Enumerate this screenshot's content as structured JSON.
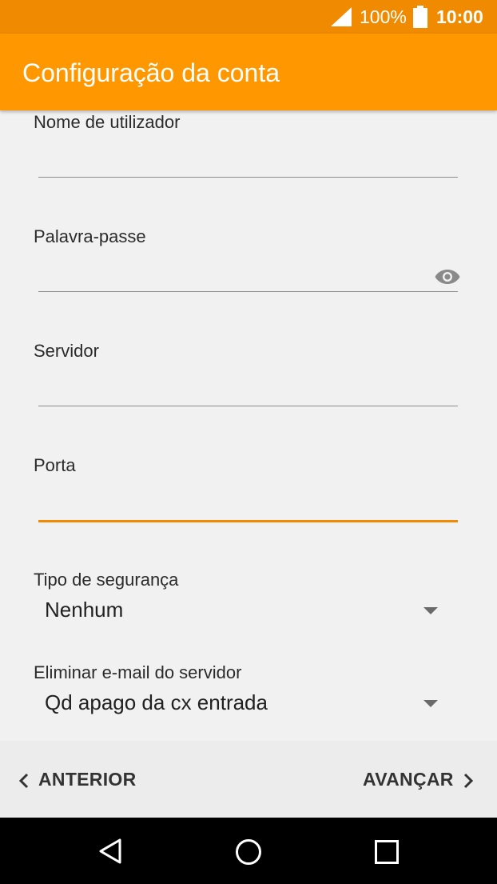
{
  "status_bar": {
    "battery_percent": "100%",
    "time": "10:00",
    "icons": [
      "signal-icon",
      "battery-icon"
    ]
  },
  "app_bar": {
    "title": "Configuração da conta"
  },
  "form": {
    "username": {
      "label": "Nome de utilizador",
      "value": ""
    },
    "password": {
      "label": "Palavra-passe",
      "value": "",
      "icon": "eye-icon"
    },
    "server": {
      "label": "Servidor",
      "value": ""
    },
    "port": {
      "label": "Porta",
      "value": "",
      "focused": true
    },
    "security_type": {
      "label": "Tipo de segurança",
      "value": "Nenhum"
    },
    "delete_email": {
      "label": "Eliminar e-mail do servidor",
      "value": "Qd apago da cx entrada"
    }
  },
  "footer_nav": {
    "previous_label": "ANTERIOR",
    "next_label": "AVANÇAR"
  },
  "colors": {
    "status_bar": "#f08a00",
    "app_bar": "#ff9800",
    "focus_underline": "#f08a00",
    "background": "#f1f1f1"
  },
  "system_nav": {
    "icons": [
      "back-icon",
      "home-icon",
      "recents-icon"
    ]
  }
}
